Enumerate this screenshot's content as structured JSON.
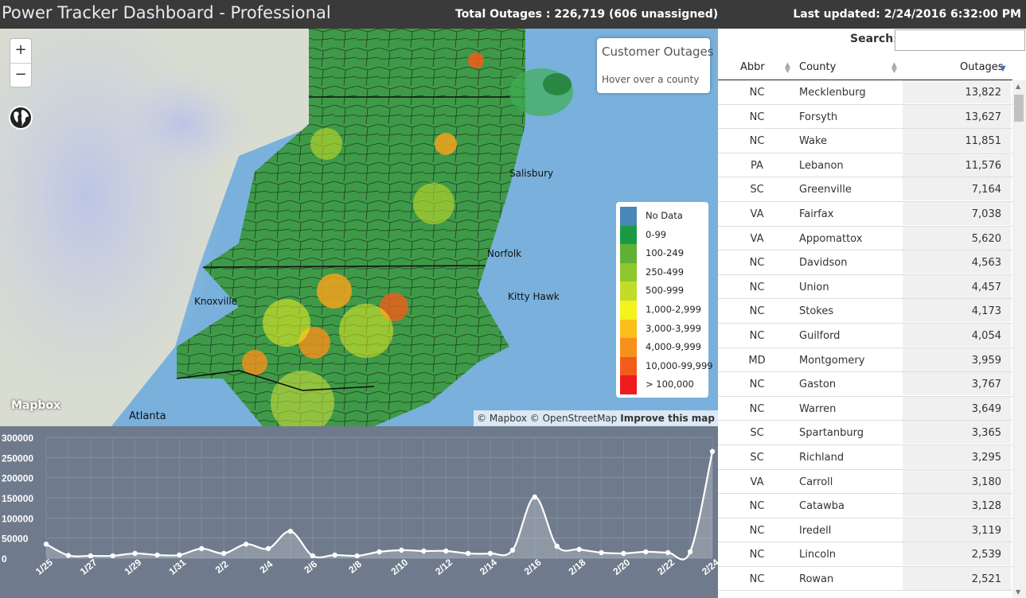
{
  "header": {
    "title": "Power Tracker Dashboard - Professional",
    "total": "Total Outages : 226,719 (606 unassigned)",
    "updated": "Last updated: 2/24/2016 6:32:00 PM"
  },
  "map": {
    "zoom_in": "+",
    "zoom_out": "−",
    "info_title": "Customer Outages",
    "info_hint": "Hover over a county",
    "logo": "Mapbox",
    "attribution": "© Mapbox © OpenStreetMap",
    "improve": "Improve this map",
    "cities": [
      "Knoxville",
      "Kitty Hawk",
      "Atlanta",
      "Salisbury",
      "Norfolk"
    ],
    "legend": [
      {
        "label": "No Data",
        "color": "#4a86b8"
      },
      {
        "label": "0-99",
        "color": "#1a9a45"
      },
      {
        "label": "100-249",
        "color": "#5fb134"
      },
      {
        "label": "250-499",
        "color": "#8ec82d"
      },
      {
        "label": "500-999",
        "color": "#c3dc2a"
      },
      {
        "label": "1,000-2,999",
        "color": "#f4f21f"
      },
      {
        "label": "3,000-3,999",
        "color": "#fbbf1a"
      },
      {
        "label": "4,000-9,999",
        "color": "#f7901c"
      },
      {
        "label": "10,000-99,999",
        "color": "#f25c1a"
      },
      {
        "label": "> 100,000",
        "color": "#ee1c1c"
      }
    ]
  },
  "chart_data": {
    "type": "area",
    "x": [
      "1/25",
      "1/26",
      "1/27",
      "1/28",
      "1/29",
      "1/30",
      "1/31",
      "2/1",
      "2/2",
      "2/3",
      "2/4",
      "2/5",
      "2/6",
      "2/7",
      "2/8",
      "2/9",
      "2/10",
      "2/11",
      "2/12",
      "2/13",
      "2/14",
      "2/15",
      "2/16",
      "2/17",
      "2/18",
      "2/19",
      "2/20",
      "2/21",
      "2/22",
      "2/23",
      "2/24"
    ],
    "tick_labels": [
      "1/25",
      "1/27",
      "1/29",
      "1/31",
      "2/2",
      "2/4",
      "2/6",
      "2/8",
      "2/10",
      "2/12",
      "2/14",
      "2/16",
      "2/18",
      "2/20",
      "2/22",
      "2/24"
    ],
    "values": [
      35000,
      7000,
      6000,
      6000,
      12000,
      8000,
      8000,
      24000,
      12000,
      35000,
      24000,
      67000,
      6000,
      8000,
      6000,
      16000,
      20000,
      18000,
      18000,
      12000,
      12000,
      20000,
      152000,
      30000,
      22000,
      14000,
      12000,
      16000,
      14000,
      16000,
      265000
    ],
    "ylim": [
      0,
      300000
    ],
    "yticks": [
      "0",
      "50000",
      "100000",
      "150000",
      "200000",
      "250000",
      "300000"
    ],
    "grid": true,
    "title": "",
    "xlabel": "",
    "ylabel": ""
  },
  "table": {
    "search_label": "Search:",
    "search_value": "",
    "columns": [
      "Abbr",
      "County",
      "Outages"
    ],
    "rows": [
      [
        "NC",
        "Mecklenburg",
        "13,822"
      ],
      [
        "NC",
        "Forsyth",
        "13,627"
      ],
      [
        "NC",
        "Wake",
        "11,851"
      ],
      [
        "PA",
        "Lebanon",
        "11,576"
      ],
      [
        "SC",
        "Greenville",
        "7,164"
      ],
      [
        "VA",
        "Fairfax",
        "7,038"
      ],
      [
        "VA",
        "Appomattox",
        "5,620"
      ],
      [
        "NC",
        "Davidson",
        "4,563"
      ],
      [
        "NC",
        "Union",
        "4,457"
      ],
      [
        "NC",
        "Stokes",
        "4,173"
      ],
      [
        "NC",
        "Guilford",
        "4,054"
      ],
      [
        "MD",
        "Montgomery",
        "3,959"
      ],
      [
        "NC",
        "Gaston",
        "3,767"
      ],
      [
        "NC",
        "Warren",
        "3,649"
      ],
      [
        "SC",
        "Spartanburg",
        "3,365"
      ],
      [
        "SC",
        "Richland",
        "3,295"
      ],
      [
        "VA",
        "Carroll",
        "3,180"
      ],
      [
        "NC",
        "Catawba",
        "3,128"
      ],
      [
        "NC",
        "Iredell",
        "3,119"
      ],
      [
        "NC",
        "Lincoln",
        "2,539"
      ],
      [
        "NC",
        "Rowan",
        "2,521"
      ]
    ]
  }
}
